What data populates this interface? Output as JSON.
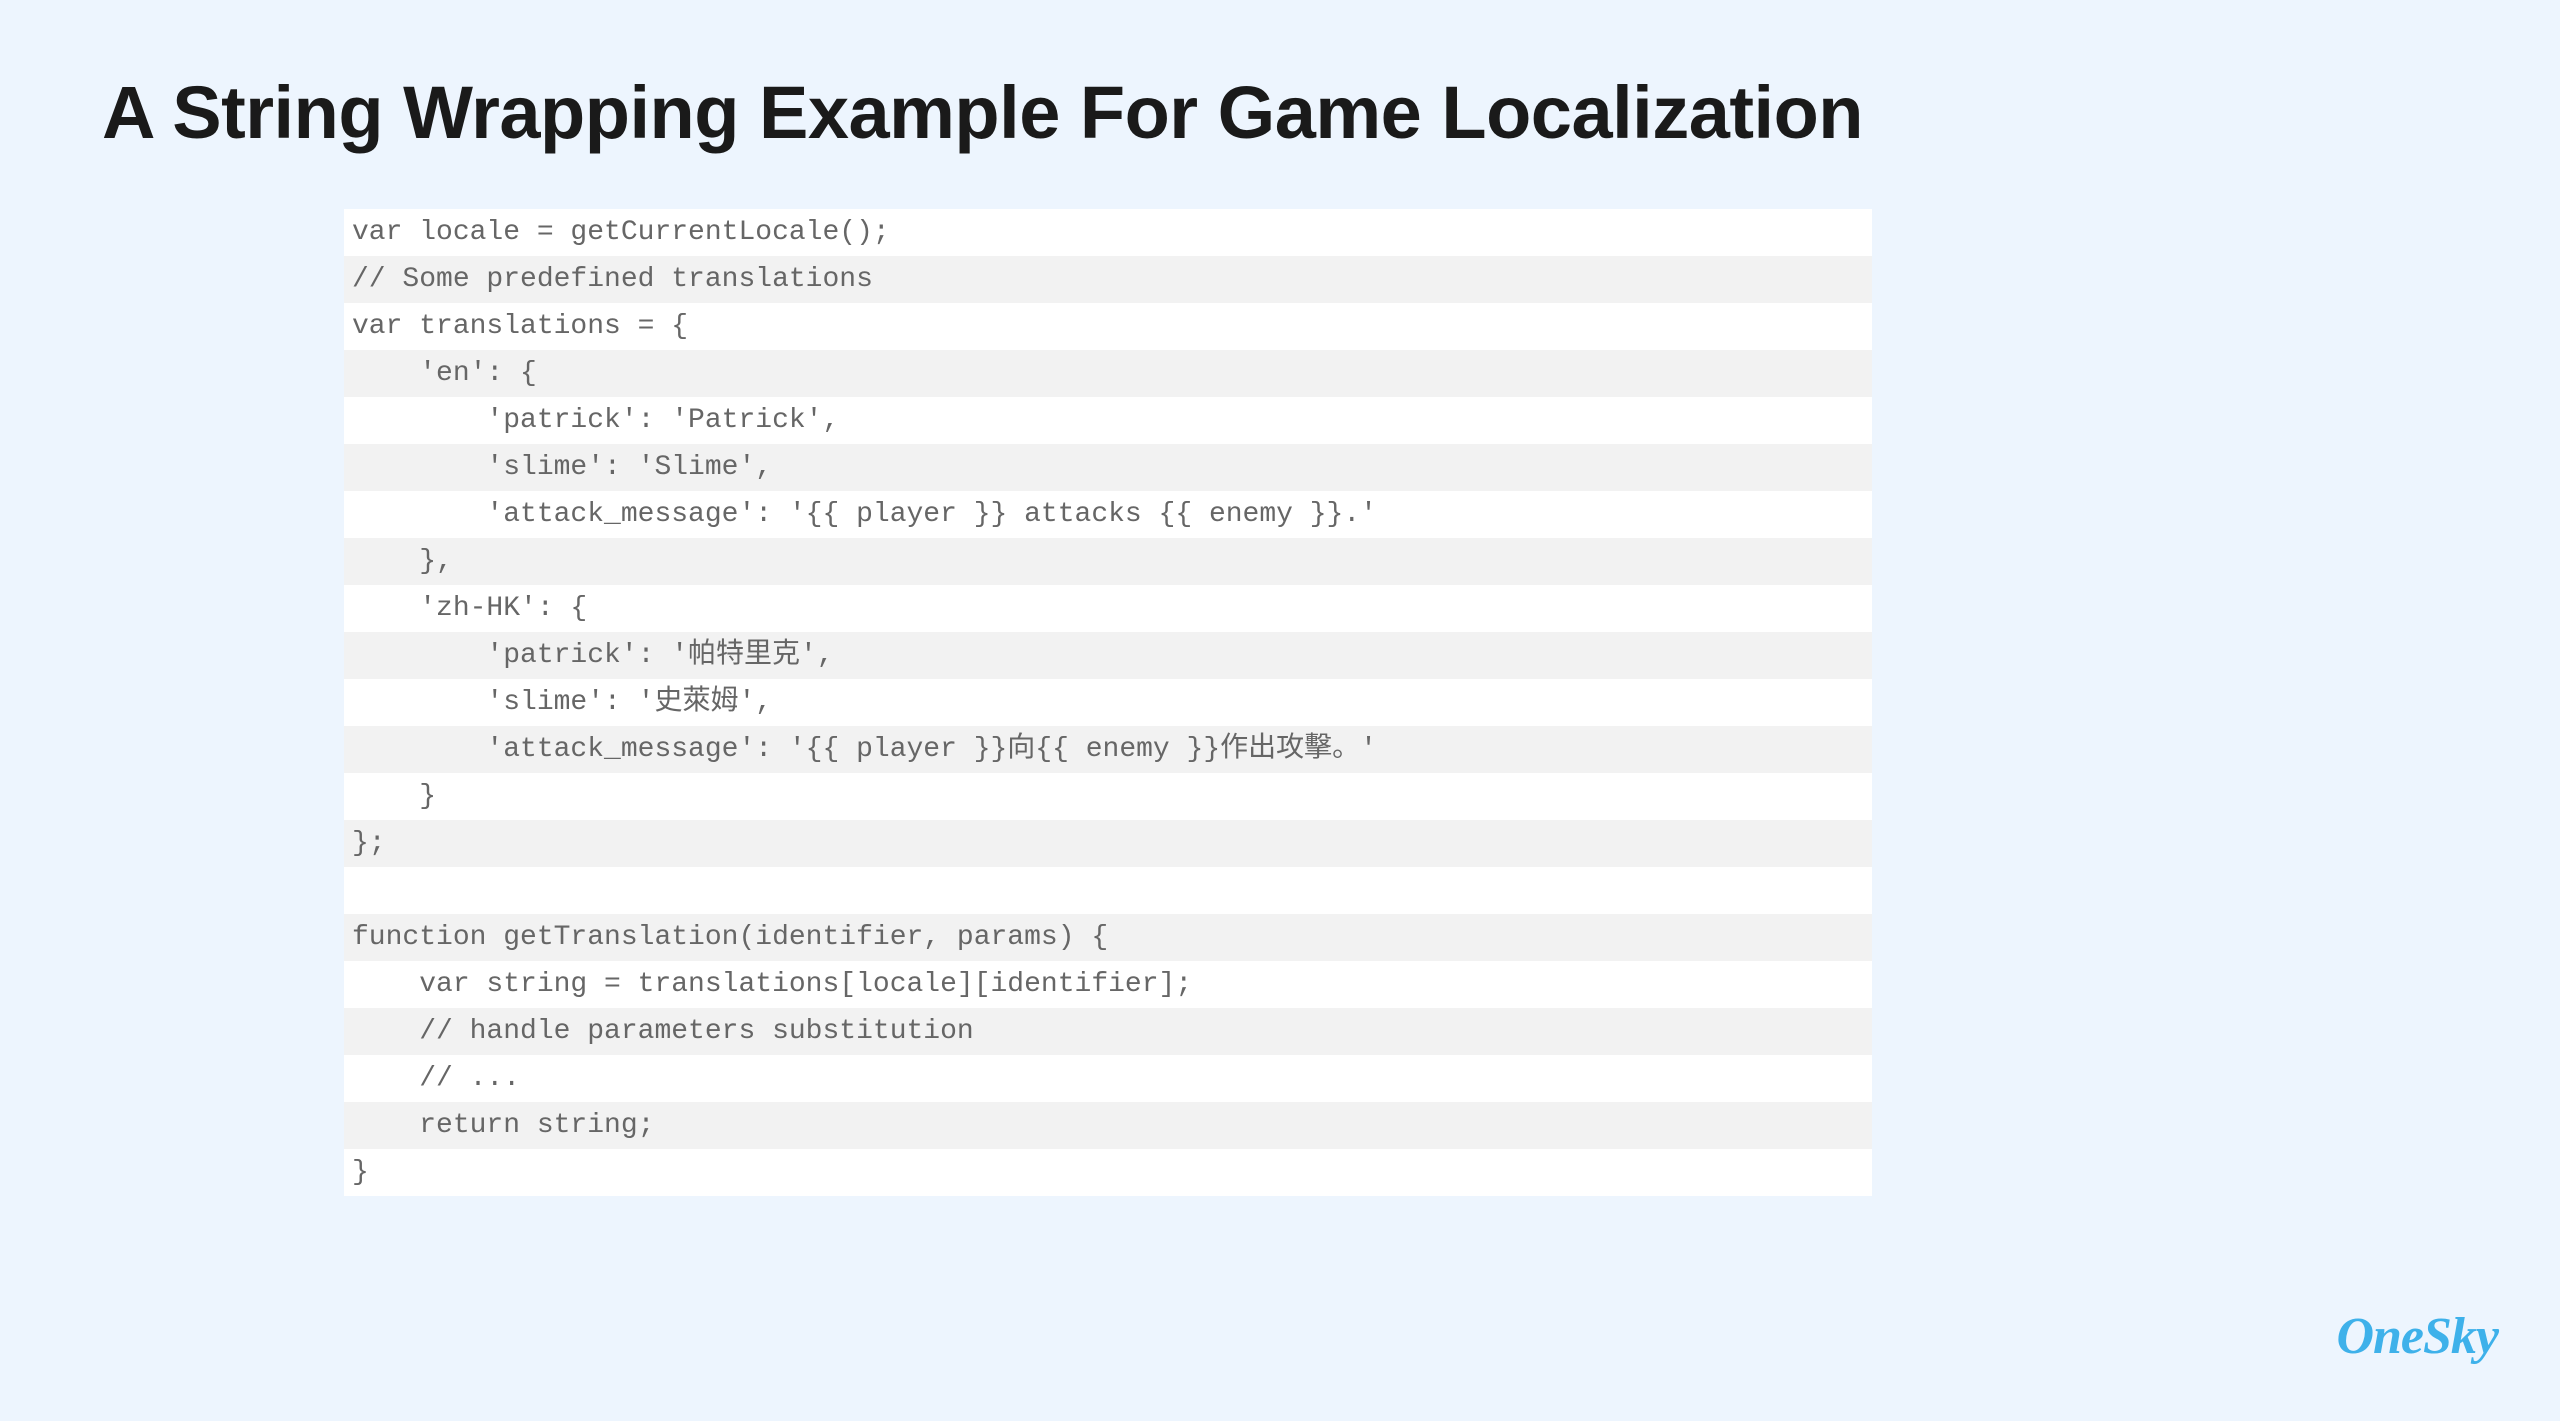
{
  "title": "A String Wrapping Example For Game Localization",
  "code_lines": [
    "var locale = getCurrentLocale();",
    "// Some predefined translations",
    "var translations = {",
    "    'en': {",
    "        'patrick': 'Patrick',",
    "        'slime': 'Slime',",
    "        'attack_message': '{{ player }} attacks {{ enemy }}.'",
    "    },",
    "    'zh-HK': {",
    "        'patrick': '帕特里克',",
    "        'slime': '史萊姆',",
    "        'attack_message': '{{ player }}向{{ enemy }}作出攻擊。'",
    "    }",
    "};",
    "",
    "function getTranslation(identifier, params) {",
    "    var string = translations[locale][identifier];",
    "    // handle parameters substitution",
    "    // ...",
    "    return string;",
    "}"
  ],
  "logo": "OneSky"
}
